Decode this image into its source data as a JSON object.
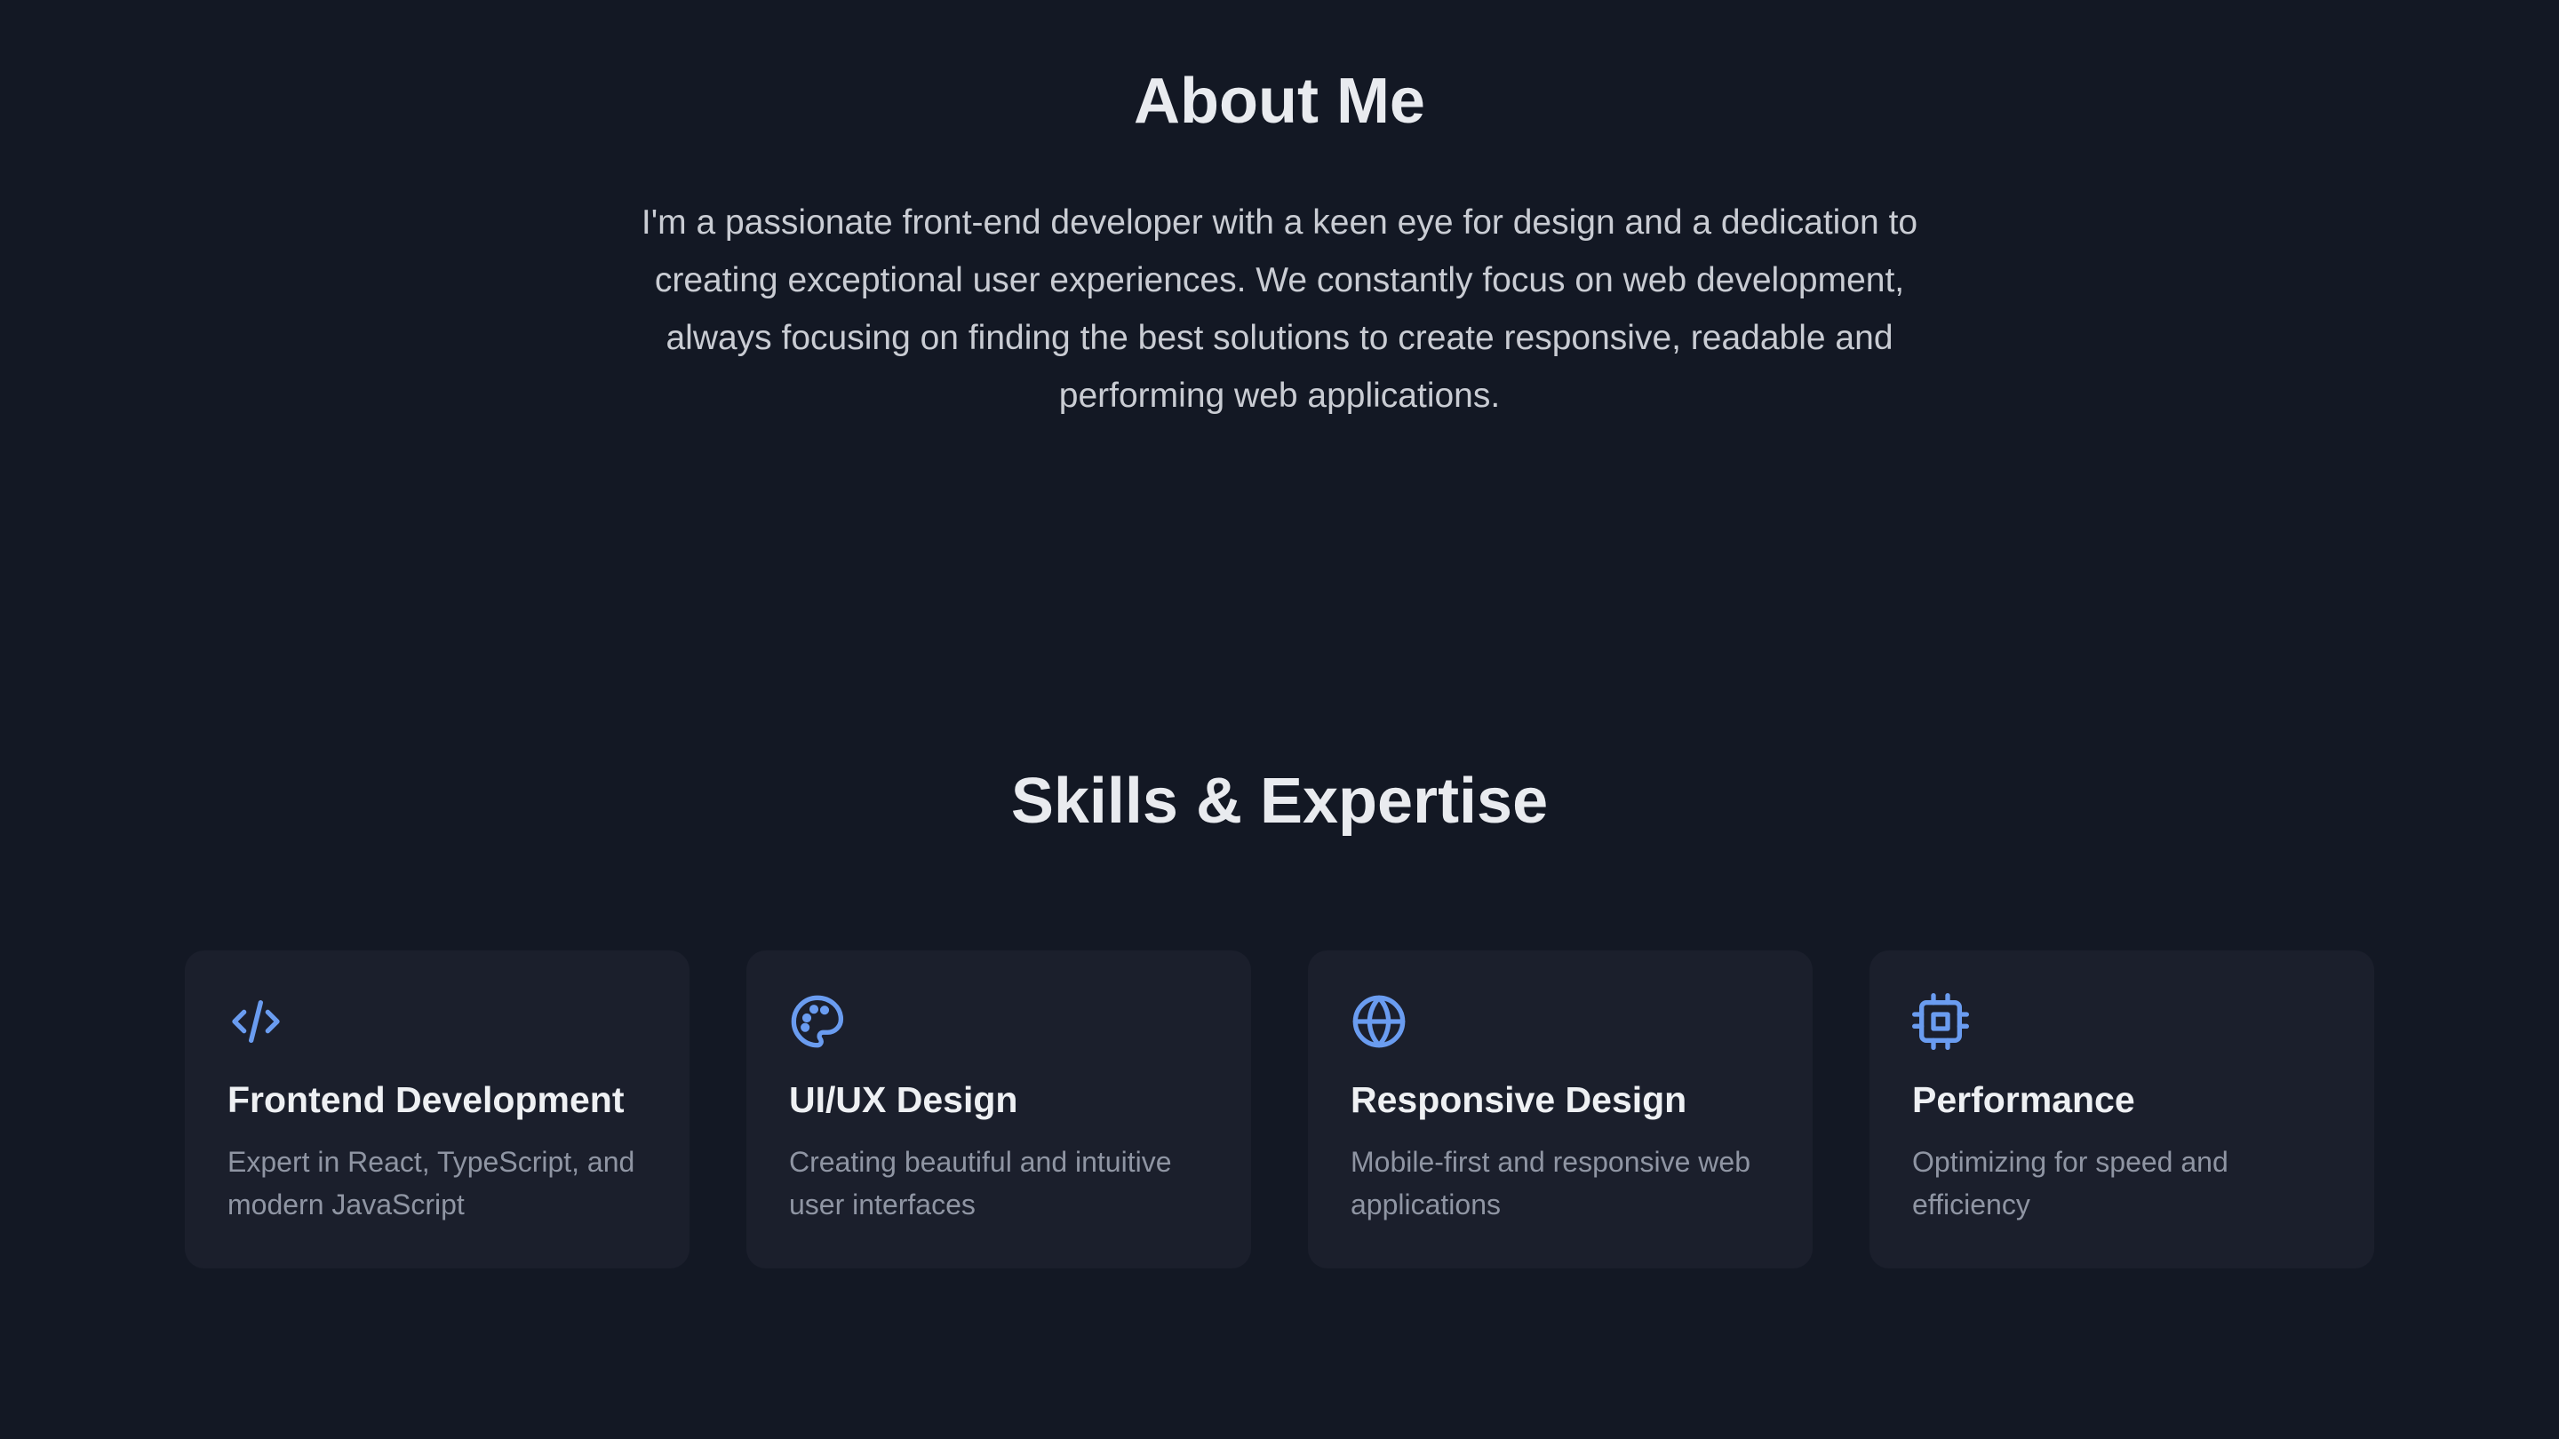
{
  "about": {
    "title": "About Me",
    "text": "I'm a passionate front-end developer with a keen eye for design and a dedication to creating exceptional user experiences. We constantly focus on web development, always focusing on finding the best solutions to create responsive, readable and performing web applications."
  },
  "skills": {
    "title": "Skills & Expertise",
    "accent_color": "#6a9cf0",
    "cards": [
      {
        "icon": "code-icon",
        "title": "Frontend Development",
        "description": "Expert in React, TypeScript, and modern JavaScript"
      },
      {
        "icon": "palette-icon",
        "title": "UI/UX Design",
        "description": "Creating beautiful and intuitive user interfaces"
      },
      {
        "icon": "globe-icon",
        "title": "Responsive Design",
        "description": "Mobile-first and responsive web applications"
      },
      {
        "icon": "cpu-icon",
        "title": "Performance",
        "description": "Optimizing for speed and efficiency"
      }
    ]
  }
}
